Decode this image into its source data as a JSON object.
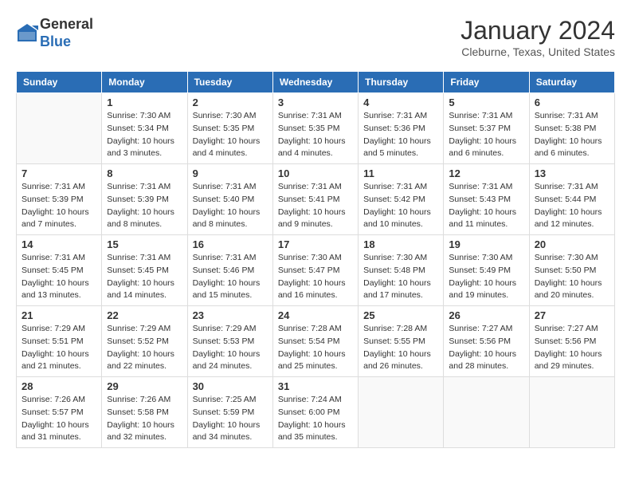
{
  "header": {
    "logo": {
      "general": "General",
      "blue": "Blue"
    },
    "title": "January 2024",
    "location": "Cleburne, Texas, United States"
  },
  "weekdays": [
    "Sunday",
    "Monday",
    "Tuesday",
    "Wednesday",
    "Thursday",
    "Friday",
    "Saturday"
  ],
  "weeks": [
    [
      {
        "day": "",
        "info": ""
      },
      {
        "day": "1",
        "info": "Sunrise: 7:30 AM\nSunset: 5:34 PM\nDaylight: 10 hours\nand 3 minutes."
      },
      {
        "day": "2",
        "info": "Sunrise: 7:30 AM\nSunset: 5:35 PM\nDaylight: 10 hours\nand 4 minutes."
      },
      {
        "day": "3",
        "info": "Sunrise: 7:31 AM\nSunset: 5:35 PM\nDaylight: 10 hours\nand 4 minutes."
      },
      {
        "day": "4",
        "info": "Sunrise: 7:31 AM\nSunset: 5:36 PM\nDaylight: 10 hours\nand 5 minutes."
      },
      {
        "day": "5",
        "info": "Sunrise: 7:31 AM\nSunset: 5:37 PM\nDaylight: 10 hours\nand 6 minutes."
      },
      {
        "day": "6",
        "info": "Sunrise: 7:31 AM\nSunset: 5:38 PM\nDaylight: 10 hours\nand 6 minutes."
      }
    ],
    [
      {
        "day": "7",
        "info": "Sunrise: 7:31 AM\nSunset: 5:39 PM\nDaylight: 10 hours\nand 7 minutes."
      },
      {
        "day": "8",
        "info": "Sunrise: 7:31 AM\nSunset: 5:39 PM\nDaylight: 10 hours\nand 8 minutes."
      },
      {
        "day": "9",
        "info": "Sunrise: 7:31 AM\nSunset: 5:40 PM\nDaylight: 10 hours\nand 8 minutes."
      },
      {
        "day": "10",
        "info": "Sunrise: 7:31 AM\nSunset: 5:41 PM\nDaylight: 10 hours\nand 9 minutes."
      },
      {
        "day": "11",
        "info": "Sunrise: 7:31 AM\nSunset: 5:42 PM\nDaylight: 10 hours\nand 10 minutes."
      },
      {
        "day": "12",
        "info": "Sunrise: 7:31 AM\nSunset: 5:43 PM\nDaylight: 10 hours\nand 11 minutes."
      },
      {
        "day": "13",
        "info": "Sunrise: 7:31 AM\nSunset: 5:44 PM\nDaylight: 10 hours\nand 12 minutes."
      }
    ],
    [
      {
        "day": "14",
        "info": "Sunrise: 7:31 AM\nSunset: 5:45 PM\nDaylight: 10 hours\nand 13 minutes."
      },
      {
        "day": "15",
        "info": "Sunrise: 7:31 AM\nSunset: 5:45 PM\nDaylight: 10 hours\nand 14 minutes."
      },
      {
        "day": "16",
        "info": "Sunrise: 7:31 AM\nSunset: 5:46 PM\nDaylight: 10 hours\nand 15 minutes."
      },
      {
        "day": "17",
        "info": "Sunrise: 7:30 AM\nSunset: 5:47 PM\nDaylight: 10 hours\nand 16 minutes."
      },
      {
        "day": "18",
        "info": "Sunrise: 7:30 AM\nSunset: 5:48 PM\nDaylight: 10 hours\nand 17 minutes."
      },
      {
        "day": "19",
        "info": "Sunrise: 7:30 AM\nSunset: 5:49 PM\nDaylight: 10 hours\nand 19 minutes."
      },
      {
        "day": "20",
        "info": "Sunrise: 7:30 AM\nSunset: 5:50 PM\nDaylight: 10 hours\nand 20 minutes."
      }
    ],
    [
      {
        "day": "21",
        "info": "Sunrise: 7:29 AM\nSunset: 5:51 PM\nDaylight: 10 hours\nand 21 minutes."
      },
      {
        "day": "22",
        "info": "Sunrise: 7:29 AM\nSunset: 5:52 PM\nDaylight: 10 hours\nand 22 minutes."
      },
      {
        "day": "23",
        "info": "Sunrise: 7:29 AM\nSunset: 5:53 PM\nDaylight: 10 hours\nand 24 minutes."
      },
      {
        "day": "24",
        "info": "Sunrise: 7:28 AM\nSunset: 5:54 PM\nDaylight: 10 hours\nand 25 minutes."
      },
      {
        "day": "25",
        "info": "Sunrise: 7:28 AM\nSunset: 5:55 PM\nDaylight: 10 hours\nand 26 minutes."
      },
      {
        "day": "26",
        "info": "Sunrise: 7:27 AM\nSunset: 5:56 PM\nDaylight: 10 hours\nand 28 minutes."
      },
      {
        "day": "27",
        "info": "Sunrise: 7:27 AM\nSunset: 5:56 PM\nDaylight: 10 hours\nand 29 minutes."
      }
    ],
    [
      {
        "day": "28",
        "info": "Sunrise: 7:26 AM\nSunset: 5:57 PM\nDaylight: 10 hours\nand 31 minutes."
      },
      {
        "day": "29",
        "info": "Sunrise: 7:26 AM\nSunset: 5:58 PM\nDaylight: 10 hours\nand 32 minutes."
      },
      {
        "day": "30",
        "info": "Sunrise: 7:25 AM\nSunset: 5:59 PM\nDaylight: 10 hours\nand 34 minutes."
      },
      {
        "day": "31",
        "info": "Sunrise: 7:24 AM\nSunset: 6:00 PM\nDaylight: 10 hours\nand 35 minutes."
      },
      {
        "day": "",
        "info": ""
      },
      {
        "day": "",
        "info": ""
      },
      {
        "day": "",
        "info": ""
      }
    ]
  ]
}
